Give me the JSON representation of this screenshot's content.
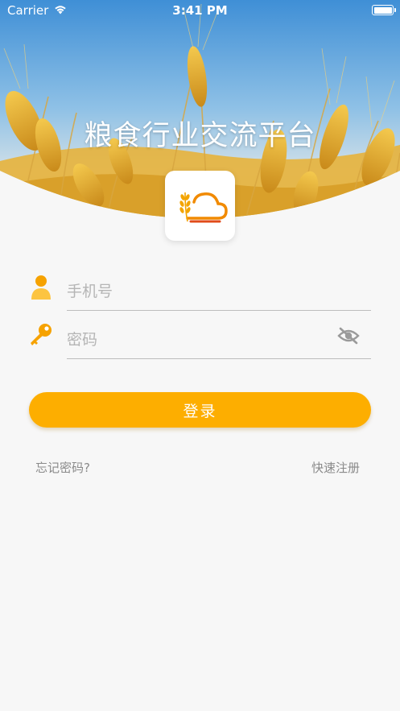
{
  "status_bar": {
    "carrier": "Carrier",
    "time": "3:41 PM"
  },
  "header": {
    "title": "粮食行业交流平台"
  },
  "form": {
    "phone_placeholder": "手机号",
    "password_placeholder": "密码",
    "login_label": "登录"
  },
  "links": {
    "forgot_password": "忘记密码?",
    "quick_register": "快速注册"
  },
  "colors": {
    "accent": "#fdae00",
    "sky": "#5aa0d8",
    "wheat": "#e2a52c"
  },
  "icons": {
    "wifi": "wifi-icon",
    "battery": "battery-icon",
    "user": "user-icon",
    "key": "key-icon",
    "visibility_off": "eye-off-icon",
    "logo": "cloud-wheat-logo"
  }
}
